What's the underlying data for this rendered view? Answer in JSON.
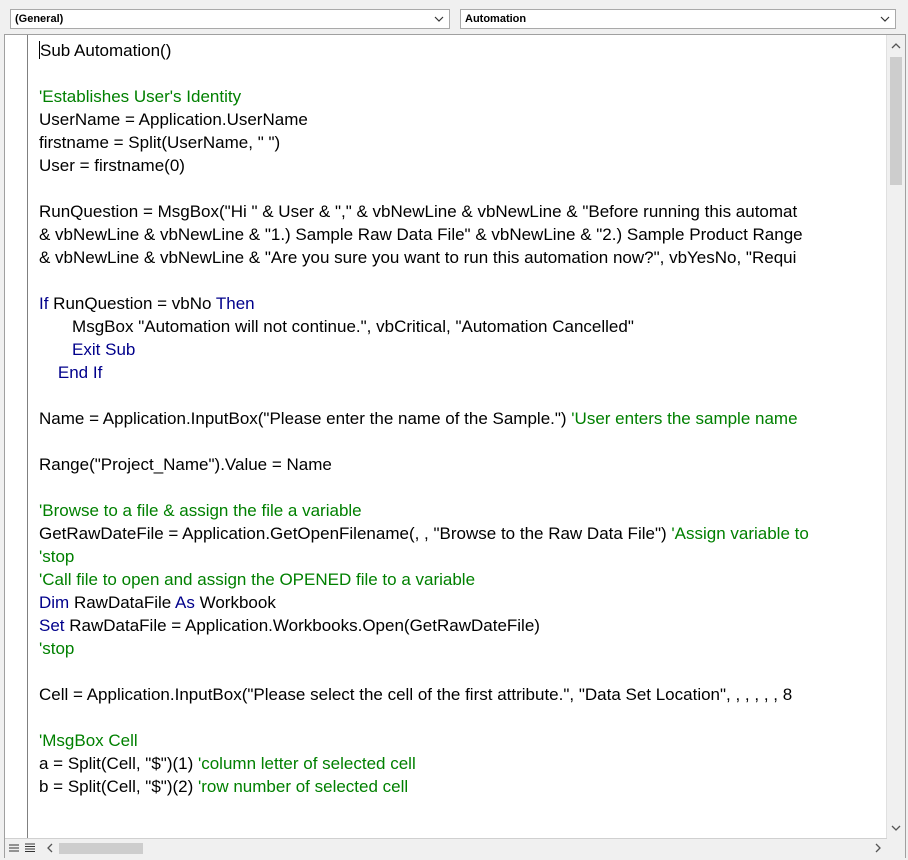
{
  "object_dropdown": {
    "value": "(General)"
  },
  "procedure_dropdown": {
    "value": "Automation"
  },
  "code_lines": [
    [
      {
        "t": "Sub Automation()",
        "c": "p"
      }
    ],
    [
      {
        "t": "",
        "c": "p"
      }
    ],
    [
      {
        "t": "'Establishes User's Identity",
        "c": "cm"
      }
    ],
    [
      {
        "t": "UserName = Application.UserName",
        "c": "p"
      }
    ],
    [
      {
        "t": "firstname = Split(UserName, \" \")",
        "c": "p"
      }
    ],
    [
      {
        "t": "User = firstname(0)",
        "c": "p"
      }
    ],
    [
      {
        "t": "",
        "c": "p"
      }
    ],
    [
      {
        "t": "RunQuestion = MsgBox(\"Hi \" & User & \",\" & vbNewLine & vbNewLine & \"Before running this automat",
        "c": "p"
      }
    ],
    [
      {
        "t": "& vbNewLine & vbNewLine & \"1.) Sample Raw Data File\" & vbNewLine & \"2.) Sample Product Range",
        "c": "p"
      }
    ],
    [
      {
        "t": "& vbNewLine & vbNewLine & \"Are you sure you want to run this automation now?\", vbYesNo, \"Requi",
        "c": "p"
      }
    ],
    [
      {
        "t": "",
        "c": "p"
      }
    ],
    [
      {
        "t": "If",
        "c": "kw"
      },
      {
        "t": " RunQuestion = vbNo ",
        "c": "p"
      },
      {
        "t": "Then",
        "c": "kw"
      }
    ],
    [
      {
        "t": "       MsgBox \"Automation will not continue.\", vbCritical, \"Automation Cancelled\"",
        "c": "p"
      }
    ],
    [
      {
        "t": "       Exit Sub",
        "c": "kw"
      }
    ],
    [
      {
        "t": "    End If",
        "c": "kw"
      }
    ],
    [
      {
        "t": "",
        "c": "p"
      }
    ],
    [
      {
        "t": "Name = Application.InputBox(\"Please enter the name of the Sample.\") ",
        "c": "p"
      },
      {
        "t": "'User enters the sample name",
        "c": "cm"
      }
    ],
    [
      {
        "t": "",
        "c": "p"
      }
    ],
    [
      {
        "t": "Range(\"Project_Name\").Value = Name",
        "c": "p"
      }
    ],
    [
      {
        "t": "",
        "c": "p"
      }
    ],
    [
      {
        "t": "'Browse to a file & assign the file a variable",
        "c": "cm"
      }
    ],
    [
      {
        "t": "GetRawDateFile = Application.GetOpenFilename(, , \"Browse to the Raw Data File\") ",
        "c": "p"
      },
      {
        "t": "'Assign variable to",
        "c": "cm"
      }
    ],
    [
      {
        "t": "'stop",
        "c": "cm"
      }
    ],
    [
      {
        "t": "'Call file to open and assign the OPENED file to a variable",
        "c": "cm"
      }
    ],
    [
      {
        "t": "Dim",
        "c": "kw"
      },
      {
        "t": " RawDataFile ",
        "c": "p"
      },
      {
        "t": "As",
        "c": "kw"
      },
      {
        "t": " Workbook",
        "c": "p"
      }
    ],
    [
      {
        "t": "Set",
        "c": "kw"
      },
      {
        "t": " RawDataFile = Application.Workbooks.Open(GetRawDateFile)",
        "c": "p"
      }
    ],
    [
      {
        "t": "'stop",
        "c": "cm"
      }
    ],
    [
      {
        "t": "",
        "c": "p"
      }
    ],
    [
      {
        "t": "Cell = Application.InputBox(\"Please select the cell of the first attribute.\", \"Data Set Location\", , , , , , 8",
        "c": "p"
      }
    ],
    [
      {
        "t": "",
        "c": "p"
      }
    ],
    [
      {
        "t": "'MsgBox Cell",
        "c": "cm"
      }
    ],
    [
      {
        "t": "a = Split(Cell, \"$\")(1) ",
        "c": "p"
      },
      {
        "t": "'column letter of selected cell",
        "c": "cm"
      }
    ],
    [
      {
        "t": "b = Split(Cell, \"$\")(2) ",
        "c": "p"
      },
      {
        "t": "'row number of selected cell",
        "c": "cm"
      }
    ]
  ],
  "icons": {
    "dropdown_arrow": "chevron-down-icon",
    "procedure_view": "procedure-view-icon",
    "full_module_view": "full-module-view-icon",
    "scroll_up": "arrow-up-icon",
    "scroll_down": "arrow-down-icon",
    "scroll_left": "arrow-left-icon",
    "scroll_right": "arrow-right-icon"
  },
  "scroll": {
    "vertical_position": 0.0,
    "horizontal_position": 0.0
  },
  "colors": {
    "keyword": "#00008b",
    "comment": "#008000",
    "text": "#000000"
  }
}
